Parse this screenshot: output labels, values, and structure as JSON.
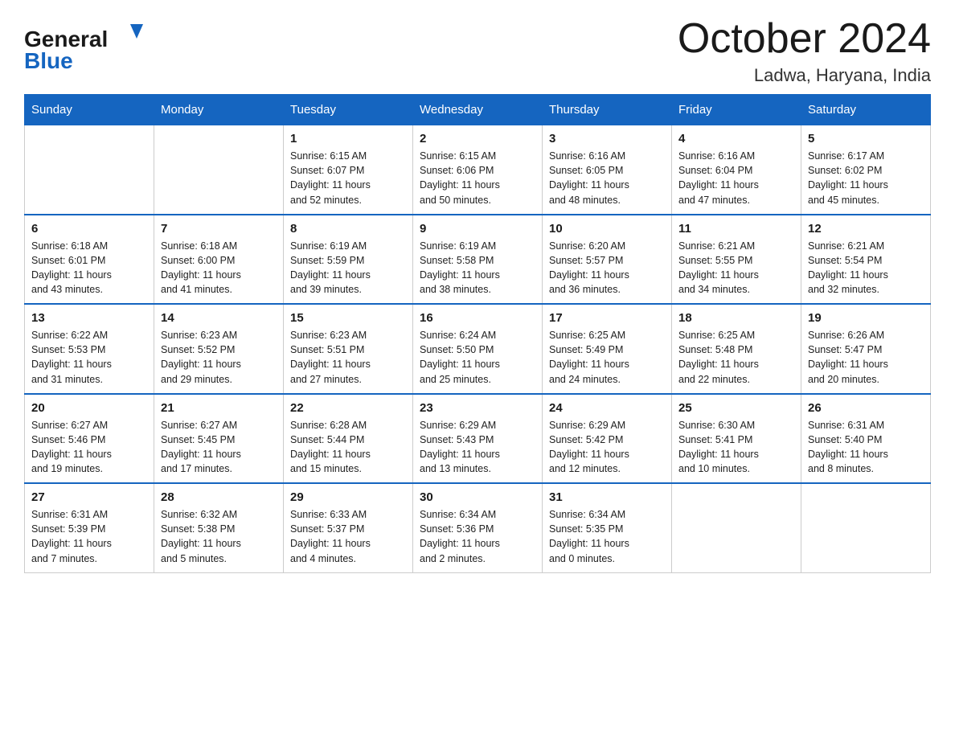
{
  "header": {
    "logo_general": "General",
    "logo_blue": "Blue",
    "month_title": "October 2024",
    "location": "Ladwa, Haryana, India"
  },
  "days_of_week": [
    "Sunday",
    "Monday",
    "Tuesday",
    "Wednesday",
    "Thursday",
    "Friday",
    "Saturday"
  ],
  "weeks": [
    [
      {
        "day": "",
        "info": ""
      },
      {
        "day": "",
        "info": ""
      },
      {
        "day": "1",
        "info": "Sunrise: 6:15 AM\nSunset: 6:07 PM\nDaylight: 11 hours\nand 52 minutes."
      },
      {
        "day": "2",
        "info": "Sunrise: 6:15 AM\nSunset: 6:06 PM\nDaylight: 11 hours\nand 50 minutes."
      },
      {
        "day": "3",
        "info": "Sunrise: 6:16 AM\nSunset: 6:05 PM\nDaylight: 11 hours\nand 48 minutes."
      },
      {
        "day": "4",
        "info": "Sunrise: 6:16 AM\nSunset: 6:04 PM\nDaylight: 11 hours\nand 47 minutes."
      },
      {
        "day": "5",
        "info": "Sunrise: 6:17 AM\nSunset: 6:02 PM\nDaylight: 11 hours\nand 45 minutes."
      }
    ],
    [
      {
        "day": "6",
        "info": "Sunrise: 6:18 AM\nSunset: 6:01 PM\nDaylight: 11 hours\nand 43 minutes."
      },
      {
        "day": "7",
        "info": "Sunrise: 6:18 AM\nSunset: 6:00 PM\nDaylight: 11 hours\nand 41 minutes."
      },
      {
        "day": "8",
        "info": "Sunrise: 6:19 AM\nSunset: 5:59 PM\nDaylight: 11 hours\nand 39 minutes."
      },
      {
        "day": "9",
        "info": "Sunrise: 6:19 AM\nSunset: 5:58 PM\nDaylight: 11 hours\nand 38 minutes."
      },
      {
        "day": "10",
        "info": "Sunrise: 6:20 AM\nSunset: 5:57 PM\nDaylight: 11 hours\nand 36 minutes."
      },
      {
        "day": "11",
        "info": "Sunrise: 6:21 AM\nSunset: 5:55 PM\nDaylight: 11 hours\nand 34 minutes."
      },
      {
        "day": "12",
        "info": "Sunrise: 6:21 AM\nSunset: 5:54 PM\nDaylight: 11 hours\nand 32 minutes."
      }
    ],
    [
      {
        "day": "13",
        "info": "Sunrise: 6:22 AM\nSunset: 5:53 PM\nDaylight: 11 hours\nand 31 minutes."
      },
      {
        "day": "14",
        "info": "Sunrise: 6:23 AM\nSunset: 5:52 PM\nDaylight: 11 hours\nand 29 minutes."
      },
      {
        "day": "15",
        "info": "Sunrise: 6:23 AM\nSunset: 5:51 PM\nDaylight: 11 hours\nand 27 minutes."
      },
      {
        "day": "16",
        "info": "Sunrise: 6:24 AM\nSunset: 5:50 PM\nDaylight: 11 hours\nand 25 minutes."
      },
      {
        "day": "17",
        "info": "Sunrise: 6:25 AM\nSunset: 5:49 PM\nDaylight: 11 hours\nand 24 minutes."
      },
      {
        "day": "18",
        "info": "Sunrise: 6:25 AM\nSunset: 5:48 PM\nDaylight: 11 hours\nand 22 minutes."
      },
      {
        "day": "19",
        "info": "Sunrise: 6:26 AM\nSunset: 5:47 PM\nDaylight: 11 hours\nand 20 minutes."
      }
    ],
    [
      {
        "day": "20",
        "info": "Sunrise: 6:27 AM\nSunset: 5:46 PM\nDaylight: 11 hours\nand 19 minutes."
      },
      {
        "day": "21",
        "info": "Sunrise: 6:27 AM\nSunset: 5:45 PM\nDaylight: 11 hours\nand 17 minutes."
      },
      {
        "day": "22",
        "info": "Sunrise: 6:28 AM\nSunset: 5:44 PM\nDaylight: 11 hours\nand 15 minutes."
      },
      {
        "day": "23",
        "info": "Sunrise: 6:29 AM\nSunset: 5:43 PM\nDaylight: 11 hours\nand 13 minutes."
      },
      {
        "day": "24",
        "info": "Sunrise: 6:29 AM\nSunset: 5:42 PM\nDaylight: 11 hours\nand 12 minutes."
      },
      {
        "day": "25",
        "info": "Sunrise: 6:30 AM\nSunset: 5:41 PM\nDaylight: 11 hours\nand 10 minutes."
      },
      {
        "day": "26",
        "info": "Sunrise: 6:31 AM\nSunset: 5:40 PM\nDaylight: 11 hours\nand 8 minutes."
      }
    ],
    [
      {
        "day": "27",
        "info": "Sunrise: 6:31 AM\nSunset: 5:39 PM\nDaylight: 11 hours\nand 7 minutes."
      },
      {
        "day": "28",
        "info": "Sunrise: 6:32 AM\nSunset: 5:38 PM\nDaylight: 11 hours\nand 5 minutes."
      },
      {
        "day": "29",
        "info": "Sunrise: 6:33 AM\nSunset: 5:37 PM\nDaylight: 11 hours\nand 4 minutes."
      },
      {
        "day": "30",
        "info": "Sunrise: 6:34 AM\nSunset: 5:36 PM\nDaylight: 11 hours\nand 2 minutes."
      },
      {
        "day": "31",
        "info": "Sunrise: 6:34 AM\nSunset: 5:35 PM\nDaylight: 11 hours\nand 0 minutes."
      },
      {
        "day": "",
        "info": ""
      },
      {
        "day": "",
        "info": ""
      }
    ]
  ]
}
